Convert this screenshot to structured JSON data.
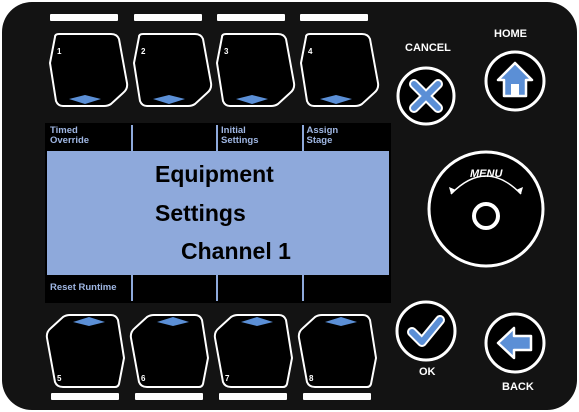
{
  "softkeys_top": [
    {
      "number": "1"
    },
    {
      "number": "2"
    },
    {
      "number": "3"
    },
    {
      "number": "4"
    }
  ],
  "softkeys_bottom": [
    {
      "number": "5"
    },
    {
      "number": "6"
    },
    {
      "number": "7"
    },
    {
      "number": "8"
    }
  ],
  "lcd": {
    "top_labels": [
      "Timed\nOverride",
      "",
      "Initial\nSettings",
      "Assign\nStage"
    ],
    "bottom_labels": [
      "Reset Runtime",
      "",
      "",
      ""
    ],
    "line1": "Equipment",
    "line2": "Settings",
    "line3": "Channel 1",
    "background_color": "#8ea9db"
  },
  "buttons": {
    "cancel_label": "CANCEL",
    "home_label": "HOME",
    "menu_label": "MENU",
    "ok_label": "OK",
    "back_label": "BACK"
  },
  "colors": {
    "accent": "#5b8fd6",
    "panel": "#131313"
  }
}
